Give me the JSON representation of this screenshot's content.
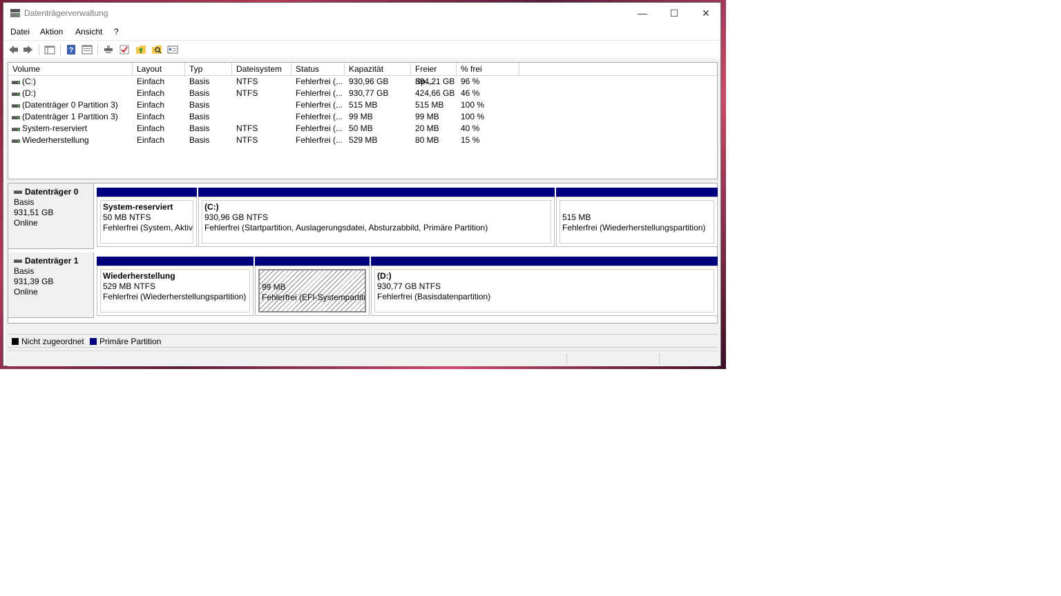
{
  "window": {
    "title": "Datenträgerverwaltung"
  },
  "menu": [
    "Datei",
    "Aktion",
    "Ansicht",
    "?"
  ],
  "toolbar": {
    "icons": [
      "back-icon",
      "forward-icon",
      "show-hide-tree-icon",
      "help-icon",
      "properties-icon",
      "connect-disk-icon",
      "check-icon",
      "up-folder-icon",
      "search-icon",
      "console-icon"
    ]
  },
  "volumes": {
    "columns": [
      "Volume",
      "Layout",
      "Typ",
      "Dateisystem",
      "Status",
      "Kapazität",
      "Freier Sp...",
      "% frei"
    ],
    "rows": [
      {
        "volume": " (C:)",
        "layout": "Einfach",
        "typ": "Basis",
        "fs": "NTFS",
        "status": "Fehlerfrei (...",
        "cap": "930,96 GB",
        "free": "894,21 GB",
        "pct": "96 %"
      },
      {
        "volume": " (D:)",
        "layout": "Einfach",
        "typ": "Basis",
        "fs": "NTFS",
        "status": "Fehlerfrei (...",
        "cap": "930,77 GB",
        "free": "424,66 GB",
        "pct": "46 %"
      },
      {
        "volume": "(Datenträger 0 Partition 3)",
        "layout": "Einfach",
        "typ": "Basis",
        "fs": "",
        "status": "Fehlerfrei (...",
        "cap": "515 MB",
        "free": "515 MB",
        "pct": "100 %"
      },
      {
        "volume": "(Datenträger 1 Partition 3)",
        "layout": "Einfach",
        "typ": "Basis",
        "fs": "",
        "status": "Fehlerfrei (...",
        "cap": "99 MB",
        "free": "99 MB",
        "pct": "100 %"
      },
      {
        "volume": "System-reserviert",
        "layout": "Einfach",
        "typ": "Basis",
        "fs": "NTFS",
        "status": "Fehlerfrei (...",
        "cap": "50 MB",
        "free": "20 MB",
        "pct": "40 %"
      },
      {
        "volume": "Wiederherstellung",
        "layout": "Einfach",
        "typ": "Basis",
        "fs": "NTFS",
        "status": "Fehlerfrei (...",
        "cap": "529 MB",
        "free": "80 MB",
        "pct": "15 %"
      }
    ]
  },
  "disks": [
    {
      "name": "Datenträger 0",
      "type": "Basis",
      "size": "931,51 GB",
      "state": "Online",
      "partitions": [
        {
          "title": "System-reserviert",
          "size": "50 MB NTFS",
          "status": "Fehlerfrei (System, Aktiv,"
        },
        {
          "title": " (C:)",
          "size": "930,96 GB NTFS",
          "status": "Fehlerfrei (Startpartition, Auslagerungsdatei, Absturzabbild, Primäre Partition)"
        },
        {
          "title": "",
          "size": "515 MB",
          "status": "Fehlerfrei (Wiederherstellungspartition)"
        }
      ]
    },
    {
      "name": "Datenträger 1",
      "type": "Basis",
      "size": "931,39 GB",
      "state": "Online",
      "partitions": [
        {
          "title": "Wiederherstellung",
          "size": "529 MB NTFS",
          "status": "Fehlerfrei (Wiederherstellungspartition)"
        },
        {
          "title": "",
          "size": "99 MB",
          "status": "Fehlerfrei (EFI-Systempartition)"
        },
        {
          "title": " (D:)",
          "size": "930,77 GB NTFS",
          "status": "Fehlerfrei (Basisdatenpartition)"
        }
      ]
    }
  ],
  "legend": [
    {
      "label": "Nicht zugeordnet",
      "color": "#000000"
    },
    {
      "label": "Primäre Partition",
      "color": "#00007f"
    }
  ],
  "colors": {
    "primary_partition": "#00007f",
    "unallocated": "#000000"
  }
}
